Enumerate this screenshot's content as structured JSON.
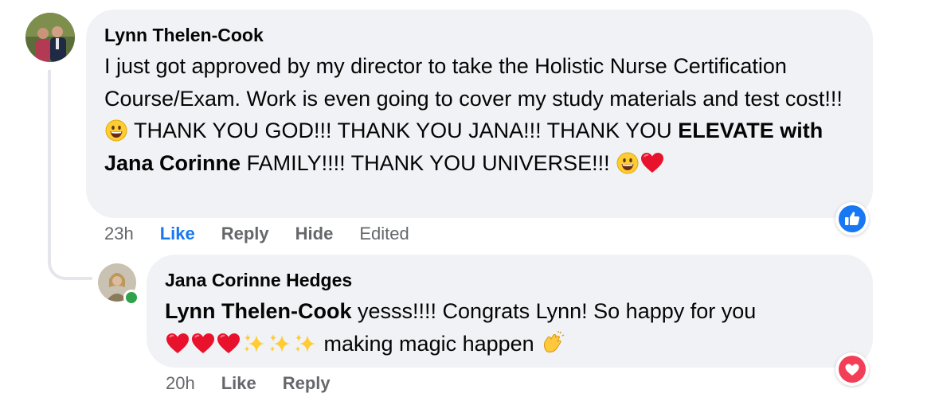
{
  "comment": {
    "author": "Lynn Thelen-Cook",
    "text_part1": "I just got approved by my director to take the Holistic Nurse Certification Course/Exam. Work is even going to cover my study materials and test cost!!!",
    "text_part2": "THANK YOU GOD!!! THANK YOU JANA!!! THANK YOU",
    "group_name": "ELEVATE with Jana Corinne",
    "text_part3": "FAMILY!!!! THANK YOU UNIVERSE!!!",
    "actions": {
      "time": "23h",
      "like": "Like",
      "reply": "Reply",
      "hide": "Hide",
      "edited": "Edited"
    },
    "reaction_icon": "like-thumb",
    "like_color": "#1877f2"
  },
  "reply": {
    "author": "Jana Corinne Hedges",
    "mention": "Lynn Thelen-Cook",
    "text_part1": "yesss!!!! Congrats Lynn! So happy for you",
    "text_part2": "making magic happen",
    "actions": {
      "time": "20h",
      "like": "Like",
      "reply": "Reply"
    },
    "reaction_icon": "love-heart",
    "love_color": "#f33e58",
    "online_color": "#31a24c"
  }
}
